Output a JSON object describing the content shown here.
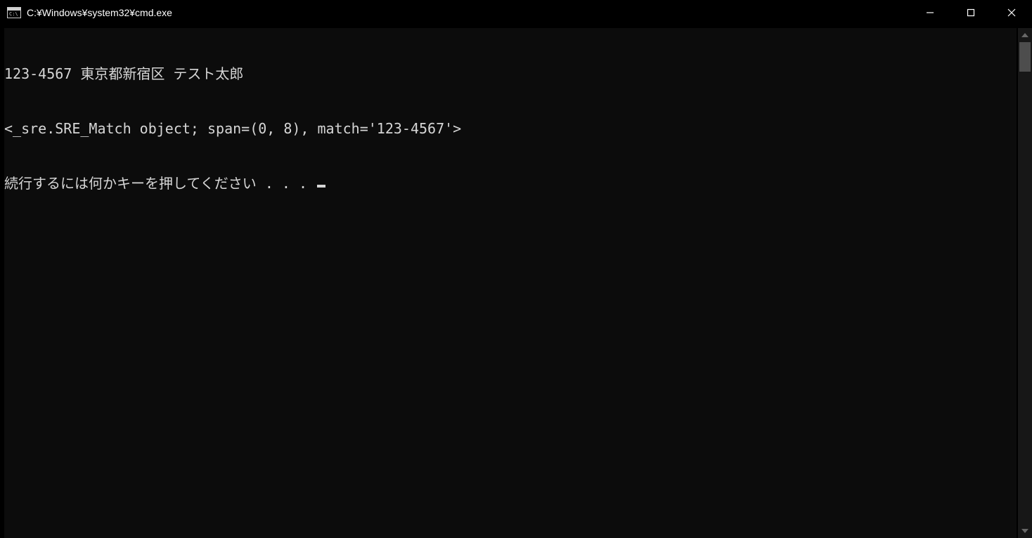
{
  "window": {
    "title": "C:¥Windows¥system32¥cmd.exe"
  },
  "terminal": {
    "lines": [
      "123-4567 東京都新宿区 テスト太郎",
      "<_sre.SRE_Match object; span=(0, 8), match='123-4567'>",
      "続行するには何かキーを押してください . . . "
    ]
  }
}
